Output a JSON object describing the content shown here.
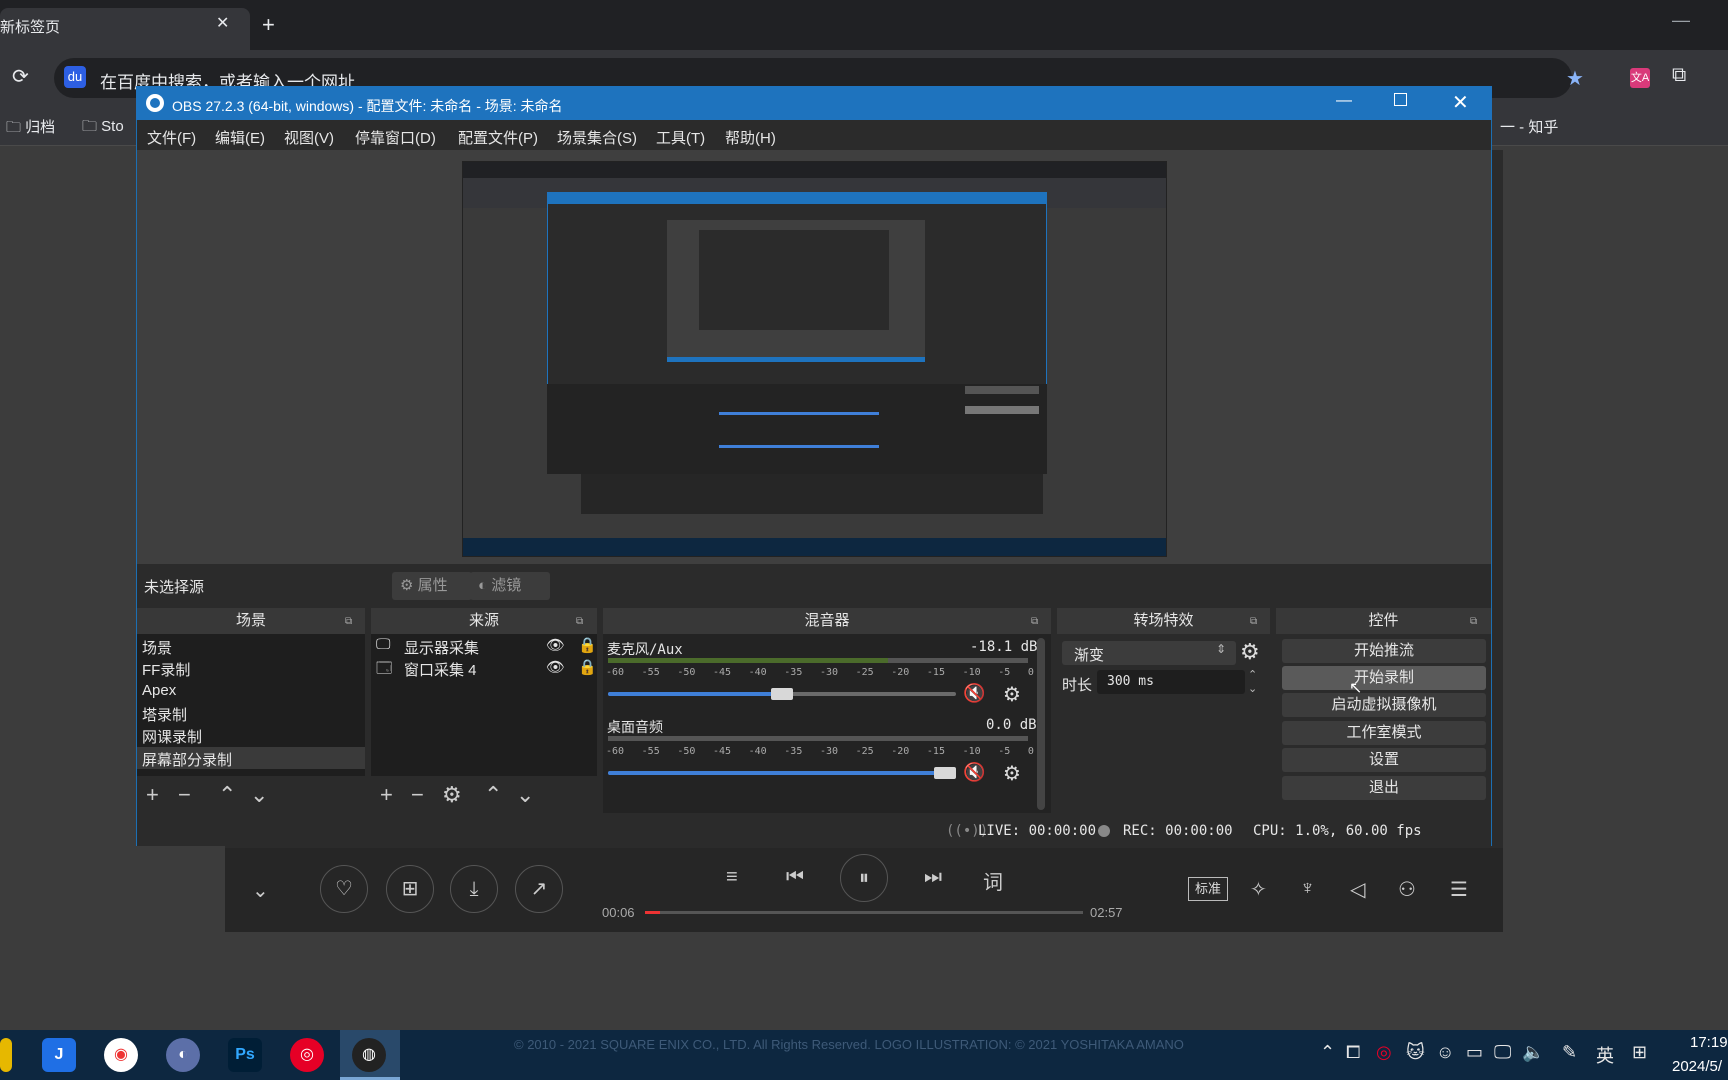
{
  "browser": {
    "tab_title": "新标签页",
    "tab_close": "✕",
    "new_tab": "+",
    "minimize": "—",
    "reload": "⟳",
    "omnibox_placeholder": "在百度中搜索，或者输入一个网址",
    "omnibox_logo": "du",
    "star": "★",
    "translate": "文A",
    "extensions": "⧉",
    "bookmarks": [
      "归档",
      "Sto",
      "一 - 知乎"
    ]
  },
  "obs": {
    "title": "OBS 27.2.3 (64-bit, windows) - 配置文件: 未命名 - 场景: 未命名",
    "min": "—",
    "close": "✕",
    "menu": [
      "文件(F)",
      "编辑(E)",
      "视图(V)",
      "停靠窗口(D)",
      "配置文件(P)",
      "场景集合(S)",
      "工具(T)",
      "帮助(H)"
    ],
    "no_source": "未选择源",
    "properties": "⚙ 属性",
    "filters": "◐ 滤镜",
    "docks": {
      "scenes": {
        "title": "场景",
        "items": [
          "场景",
          "FF录制",
          "Apex",
          "塔录制",
          "网课录制",
          "屏幕部分录制"
        ],
        "selected_index": 5
      },
      "sources": {
        "title": "来源",
        "items": [
          "显示器采集",
          "窗口采集 4"
        ]
      },
      "mixer": {
        "title": "混音器",
        "channels": [
          {
            "name": "麦克风/Aux",
            "db": "-18.1 dB",
            "volume": 0.5
          },
          {
            "name": "桌面音频",
            "db": "0.0 dB",
            "volume": 1.0
          }
        ],
        "scale": [
          "-60",
          "-55",
          "-50",
          "-45",
          "-40",
          "-35",
          "-30",
          "-25",
          "-20",
          "-15",
          "-10",
          "-5",
          "0"
        ]
      },
      "transitions": {
        "title": "转场特效",
        "type": "渐变",
        "duration_label": "时长",
        "duration": "300 ms"
      },
      "controls": {
        "title": "控件",
        "buttons": [
          "开始推流",
          "开始录制",
          "启动虚拟摄像机",
          "工作室模式",
          "设置",
          "退出"
        ]
      }
    },
    "status": {
      "live": "LIVE: 00:00:00",
      "rec": "REC: 00:00:00",
      "cpu": "CPU: 1.0%, 60.00 fps"
    }
  },
  "music": {
    "time_current": "00:06",
    "time_total": "02:57",
    "progress": 0.034,
    "lyrics_btn": "词",
    "quality_badge": "标准"
  },
  "taskbar": {
    "copyright": "© 2010 - 2021 SQUARE ENIX CO., LTD. All Rights Reserved. LOGO ILLUSTRATION: © 2021 YOSHITAKA AMANO",
    "ime": "英",
    "time": "17:19",
    "date": "2024/5/"
  },
  "colors": {
    "obs_title_blue": "#1e73be",
    "mute_red": "#e0202a",
    "slider_blue": "#3f7fd8"
  }
}
